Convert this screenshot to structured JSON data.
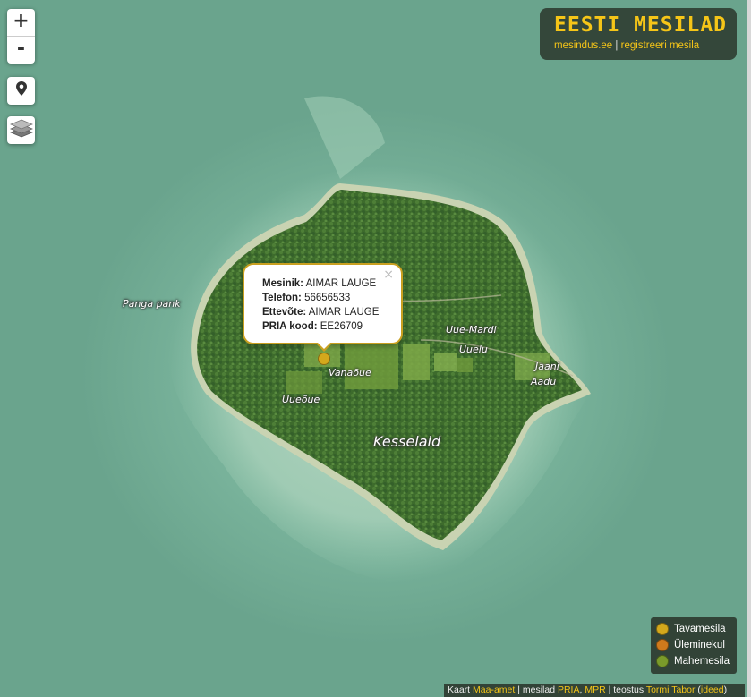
{
  "app": {
    "title": "EESTI MESILAD",
    "link_home": "mesindus.ee",
    "separator": "|",
    "link_register": "registreeri mesila"
  },
  "controls": {
    "zoom_in": "+",
    "zoom_out": "-",
    "locate_icon": "map-pin-icon",
    "layers_icon": "layers-icon"
  },
  "popup": {
    "close": "×",
    "rows": [
      {
        "label": "Mesinik:",
        "value": "AIMAR LAUGE"
      },
      {
        "label": "Telefon:",
        "value": "56656533"
      },
      {
        "label": "Ettevõte:",
        "value": "AIMAR LAUGE"
      },
      {
        "label": "PRIA kood:",
        "value": "EE26709"
      }
    ]
  },
  "places": {
    "panga_pank": "Panga pank",
    "uue_mardi": "Uue-Mardi",
    "uuelu": "Uuelu",
    "jaani": "Jaani",
    "aadu": "Aadu",
    "vanaoue": "Vanaõue",
    "uueoue": "Uueõue",
    "island": "Kesselaid"
  },
  "legend": [
    {
      "label": "Tavamesila",
      "color": "#d4a81c"
    },
    {
      "label": "Üleminekul",
      "color": "#d07a1c"
    },
    {
      "label": "Mahemesila",
      "color": "#7a9a2a"
    }
  ],
  "attribution": {
    "kaart": "Kaart",
    "maa_amet": "Maa-amet",
    "sep1": "| mesilad",
    "pria": "PRIA",
    "comma": ",",
    "mpr": "MPR",
    "sep2": "| teostus",
    "author": "Tormi Tabor",
    "paren_open": "(",
    "ideas": "ideed",
    "paren_close": ")"
  },
  "colors": {
    "accent": "#f5c518",
    "water": "#7bb59d",
    "forest": "#3f6e2e"
  }
}
